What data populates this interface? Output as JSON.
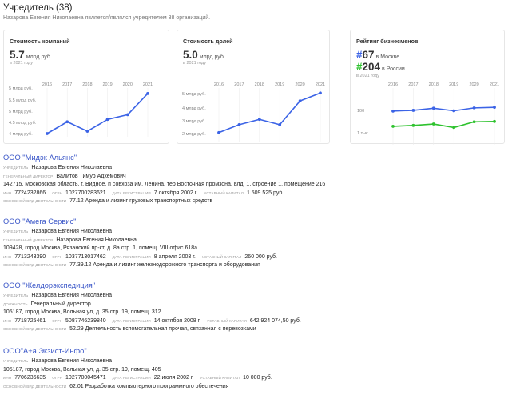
{
  "header": {
    "title": "Учредитель (38)",
    "subtitle": "Назарова Евгения Николаевна является/являлся учредителем 38 организаций."
  },
  "cards": {
    "company_value": {
      "title": "Стоимость компаний",
      "big_value": "5.7",
      "big_unit": "млрд руб.",
      "note": "в 2021 году",
      "y_ticks": [
        "5 млрд руб.",
        "5.5 млрд руб.",
        "5 млрд руб.",
        "4.5 млрд руб.",
        "4 млрд руб."
      ],
      "x_ticks": [
        "2016",
        "2017",
        "2018",
        "2019",
        "2020",
        "2021"
      ]
    },
    "share_value": {
      "title": "Стоимость долей",
      "big_value": "5.0",
      "big_unit": "млрд руб.",
      "note": "в 2021 году",
      "y_ticks": [
        "5 млрд руб.",
        "4 млрд руб.",
        "3 млрд руб.",
        "2 млрд руб."
      ],
      "x_ticks": [
        "2016",
        "2017",
        "2018",
        "2019",
        "2020",
        "2021"
      ]
    },
    "rating": {
      "title": "Рейтинг бизнесменов",
      "moscow_hash": "#",
      "moscow_num": "67",
      "moscow_loc": "в Москве",
      "russia_hash": "#",
      "russia_num": "204",
      "russia_loc": "в России",
      "note": "в 2021 году",
      "y_ticks": [
        "100",
        "1 тыс."
      ],
      "x_ticks": [
        "2016",
        "2017",
        "2018",
        "2019",
        "2020",
        "2021"
      ]
    }
  },
  "chart_data": [
    {
      "type": "line",
      "title": "Стоимость компаний",
      "x": [
        "2016",
        "2017",
        "2018",
        "2019",
        "2020",
        "2021"
      ],
      "series": [
        {
          "values": [
            4.0,
            4.5,
            4.1,
            4.6,
            4.8,
            5.7
          ]
        }
      ],
      "ylim": [
        4,
        6
      ],
      "color": "#3b63e6"
    },
    {
      "type": "line",
      "title": "Стоимость долей",
      "x": [
        "2016",
        "2017",
        "2018",
        "2019",
        "2020",
        "2021"
      ],
      "series": [
        {
          "values": [
            2.0,
            2.6,
            3.0,
            2.6,
            4.4,
            5.0
          ]
        }
      ],
      "ylim": [
        1.5,
        5.5
      ],
      "color": "#3b63e6"
    },
    {
      "type": "line",
      "title": "Рейтинг бизнесменов",
      "x": [
        "2016",
        "2017",
        "2018",
        "2019",
        "2020",
        "2021"
      ],
      "series": [
        {
          "name": "в Москве",
          "values": [
            90,
            85,
            72,
            88,
            70,
            67
          ],
          "color": "#3b63e6"
        },
        {
          "name": "в России",
          "values": [
            300,
            280,
            250,
            330,
            210,
            204
          ],
          "color": "#2ec22e"
        }
      ],
      "ylim": [
        40,
        1000
      ],
      "yscale": "log"
    }
  ],
  "labels": {
    "founder": "УЧРЕДИТЕЛЬ",
    "general_director": "ГЕНЕРАЛЬНЫЙ ДИРЕКТОР",
    "position": "ДОЛЖНОСТЬ",
    "inn": "ИНН",
    "ogrn": "ОГРН",
    "reg_date": "ДАТА РЕГИСТРАЦИИ",
    "capital": "УСТАВНЫЙ КАПИТАЛ",
    "main_activity": "ОСНОВНОЙ ВИД ДЕЯТЕЛЬНОСТИ"
  },
  "orgs": [
    {
      "name": "ООО \"Мидэк Альянс\"",
      "founder": "Назарова Евгения Николаевна",
      "director": "Валитов Тимур Адхемович",
      "address": "142715, Московская область, г. Видное, п совхоза им. Ленина, тер Восточная промзона, влд. 1, строение 1, помещение 216",
      "inn": "7724232866",
      "ogrn": "1027700283621",
      "reg_date": "7 октября 2002 г.",
      "capital": "1 509 525 руб.",
      "activity": "77.12 Аренда и лизинг грузовых транспортных средств"
    },
    {
      "name": "ООО \"Амега Сервис\"",
      "founder": "Назарова Евгения Николаевна",
      "director": "Назарова Евгения Николаевна",
      "address": "109428, город Москва, Рязанский пр-кт, д. 8а стр. 1, помещ. VIII офис 618а",
      "inn": "7713243390",
      "ogrn": "1037713017462",
      "reg_date": "8 апреля 2003 г.",
      "capital": "260 000 руб.",
      "activity": "77.39.12 Аренда и лизинг железнодорожного транспорта и оборудования"
    },
    {
      "name": "ООО \"Желдорэкспедиция\"",
      "founder": "Назарова Евгения Николаевна",
      "position": "Генеральный директор",
      "address": "105187, город Москва, Вольная ул, д. 35 стр. 19, помещ. 312",
      "inn": "7718725461",
      "ogrn": "5087746239840",
      "reg_date": "14 октября 2008 г.",
      "capital": "642 924 074,50 руб.",
      "activity": "52.29 Деятельность вспомогательная прочая, связанная с перевозками"
    },
    {
      "name": "ООО\"А+а Экзист-Инфо\"",
      "founder": "Назарова Евгения Николаевна",
      "address": "105187, город Москва, Вольная ул, д. 35 стр. 19, помещ. 405",
      "inn": "7706236635",
      "ogrn": "1027700045471",
      "reg_date": "22 июля 2002 г.",
      "capital": "10 000 руб.",
      "activity": "62.01 Разработка компьютерного программного обеспечения"
    }
  ]
}
